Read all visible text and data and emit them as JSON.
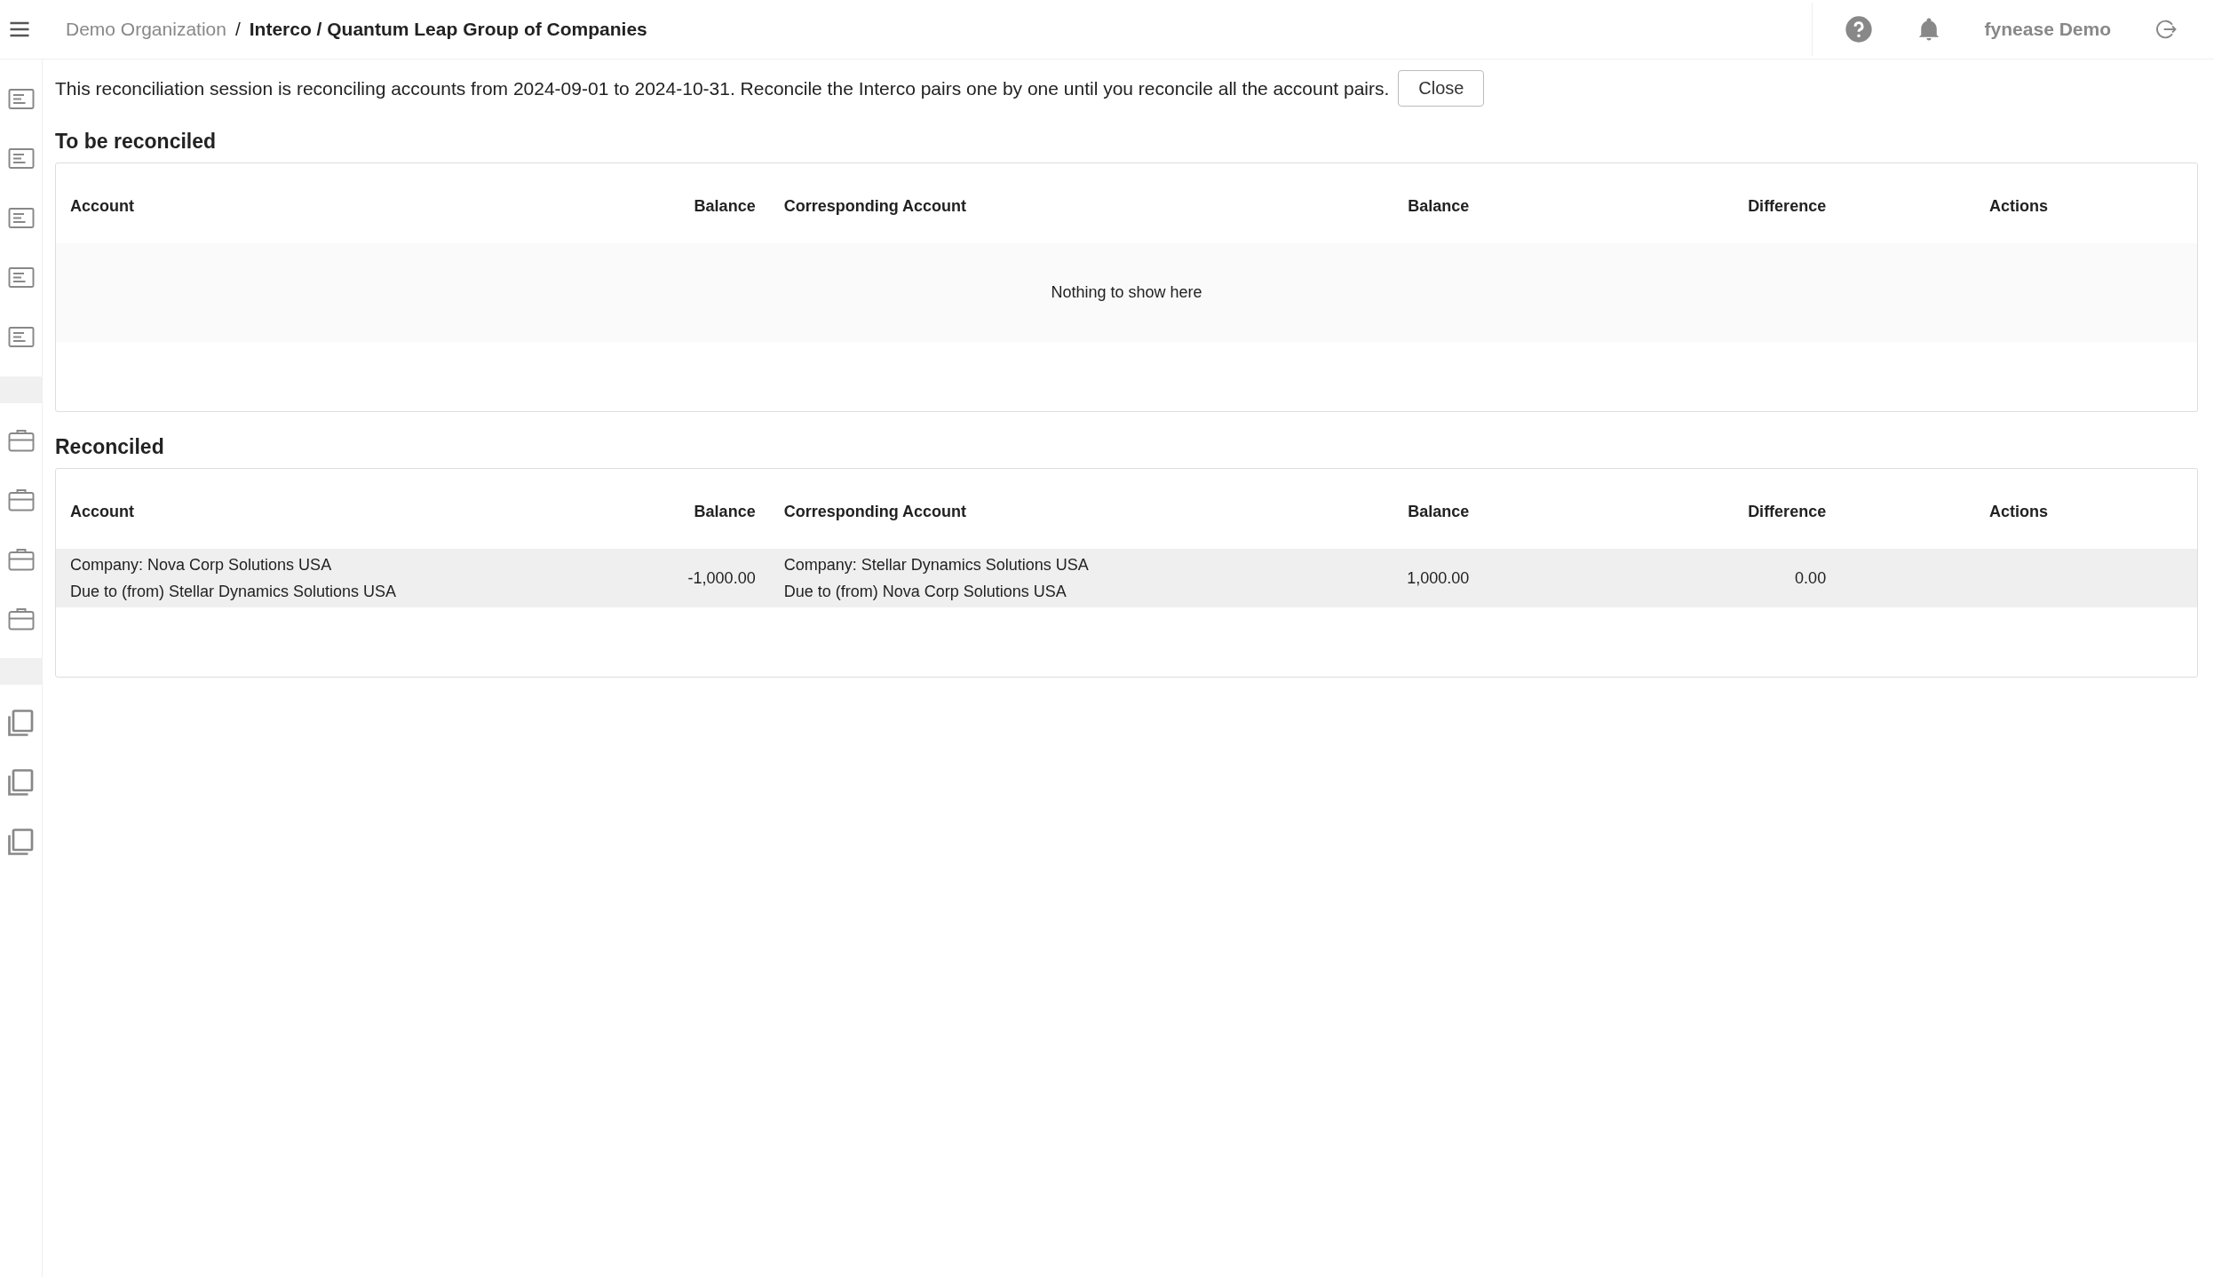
{
  "breadcrumb": {
    "parent": "Demo Organization",
    "separator": "/",
    "current": "Interco / Quantum Leap Group of Companies"
  },
  "user": {
    "name": "fynease Demo"
  },
  "notice": {
    "text": "This reconciliation session is reconciling accounts from 2024-09-01 to 2024-10-31. Reconcile the Interco pairs one by one until you reconcile all the account pairs.",
    "button": "Close"
  },
  "sections": [
    {
      "title": "To be reconciled",
      "columns": [
        "Account",
        "Balance",
        "Corresponding Account",
        "Balance",
        "Difference",
        "Actions"
      ],
      "empty_message": "Nothing to show here"
    },
    {
      "title": "Reconciled",
      "columns": [
        "Account",
        "Balance",
        "Corresponding Account",
        "Balance",
        "Difference",
        "Actions"
      ],
      "rows": [
        {
          "account": [
            "Company: Nova Corp Solutions USA",
            "Due to (from) Stellar Dynamics Solutions USA"
          ],
          "balance": "-1,000.00",
          "corresponding_account": [
            "Company: Stellar Dynamics Solutions USA",
            "Due to (from) Nova Corp Solutions USA"
          ],
          "corresponding_balance": "1,000.00",
          "difference": "0.00"
        }
      ]
    }
  ]
}
